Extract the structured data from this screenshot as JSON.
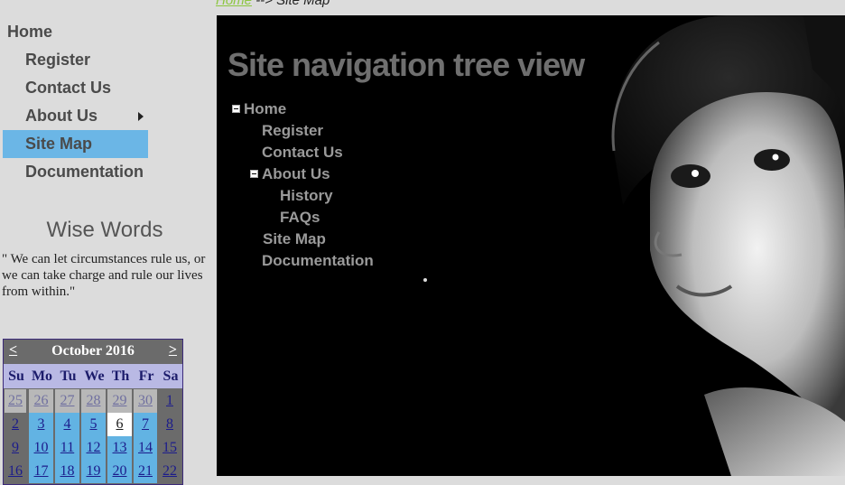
{
  "breadcrumb": {
    "link": "Home",
    "separator": "-->",
    "current": "Site Map"
  },
  "menu": {
    "items": [
      {
        "label": "Home"
      },
      {
        "label": "Register"
      },
      {
        "label": "Contact Us"
      },
      {
        "label": "About Us"
      },
      {
        "label": "Site Map",
        "active": true
      },
      {
        "label": "Documentation"
      }
    ]
  },
  "wise": {
    "title": "Wise Words",
    "quote": "\" We can let circumstances rule us, or we can take charge and rule our lives from within.\""
  },
  "calendar": {
    "prev": "<",
    "next": ">",
    "month": "October 2016",
    "dow": [
      "Su",
      "Mo",
      "Tu",
      "We",
      "Th",
      "Fr",
      "Sa"
    ],
    "rows": [
      [
        "25",
        "26",
        "27",
        "28",
        "29",
        "30",
        "1"
      ],
      [
        "2",
        "3",
        "4",
        "5",
        "6",
        "7",
        "8"
      ],
      [
        "9",
        "10",
        "11",
        "12",
        "13",
        "14",
        "15"
      ],
      [
        "16",
        "17",
        "18",
        "19",
        "20",
        "21",
        "22"
      ]
    ],
    "today": "6"
  },
  "content": {
    "title": "Site navigation tree view",
    "tree": [
      {
        "label": "Home"
      },
      {
        "label": "Register"
      },
      {
        "label": "Contact Us"
      },
      {
        "label": "About Us"
      },
      {
        "label": "History"
      },
      {
        "label": "FAQs"
      },
      {
        "label": "Site Map"
      },
      {
        "label": "Documentation"
      }
    ]
  }
}
